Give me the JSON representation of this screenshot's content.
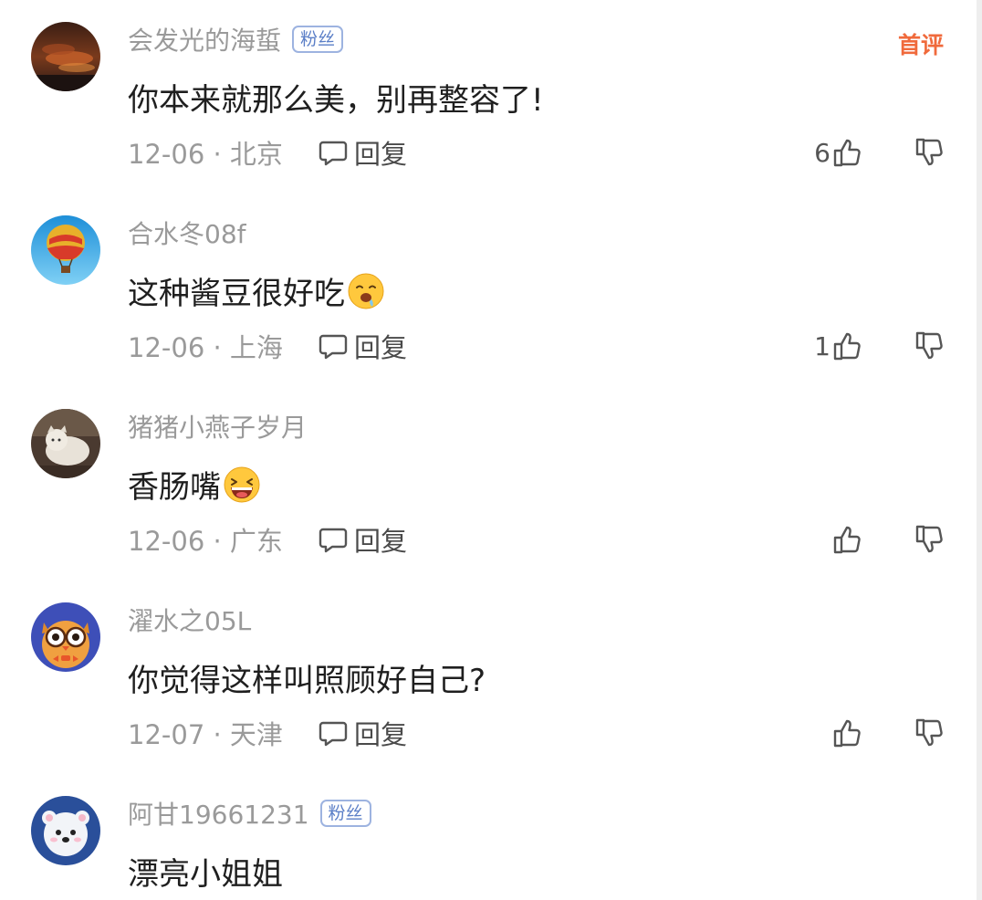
{
  "comments": [
    {
      "username": "会发光的海蜇",
      "badge": "粉丝",
      "tag": "首评",
      "text": "你本来就那么美，别再整容了!",
      "date": "12-06",
      "location": "北京",
      "meta": "12-06 · 北京",
      "reply_label": "回复",
      "likes": "6",
      "avatar_icon": "sunset-sky-avatar"
    },
    {
      "username": "合水冬08f",
      "text": "这种酱豆很好吃",
      "emoji": "drooling-face-emoji",
      "date": "12-06",
      "location": "上海",
      "meta": "12-06 · 上海",
      "reply_label": "回复",
      "likes": "1",
      "avatar_icon": "hot-air-balloon-avatar"
    },
    {
      "username": "猪猪小燕子岁月",
      "text": "香肠嘴",
      "emoji": "grinning-face-emoji",
      "date": "12-06",
      "location": "广东",
      "meta": "12-06 · 广东",
      "reply_label": "回复",
      "likes": "",
      "avatar_icon": "cat-photo-avatar"
    },
    {
      "username": "濯水之05L",
      "text": "你觉得这样叫照顾好自己?",
      "date": "12-07",
      "location": "天津",
      "meta": "12-07 · 天津",
      "reply_label": "回复",
      "likes": "",
      "avatar_icon": "owl-cartoon-avatar"
    },
    {
      "username": "阿甘19661231",
      "badge": "粉丝",
      "text": "漂亮小姐姐",
      "avatar_icon": "bear-cartoon-avatar"
    }
  ],
  "colors": {
    "username": "#9a9a9a",
    "badge": "#5b7fc7",
    "first_tag": "#f06a3c",
    "text": "#1f1f1f"
  }
}
